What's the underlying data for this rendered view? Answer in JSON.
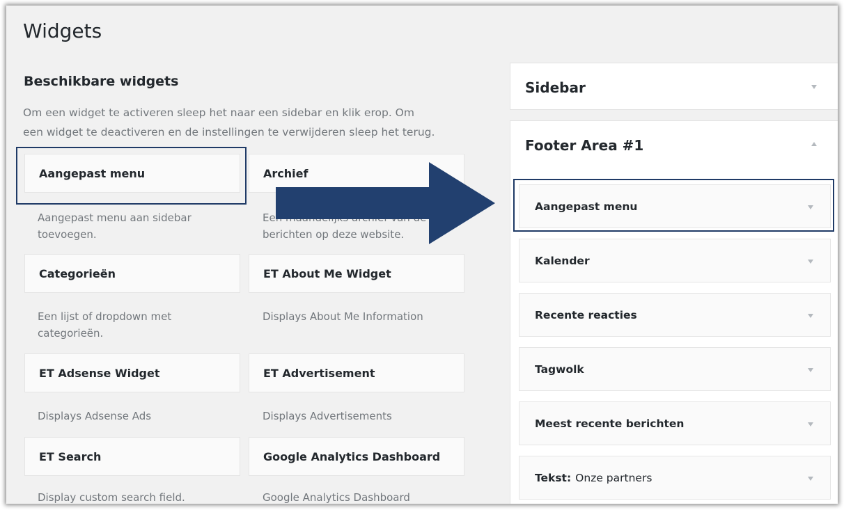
{
  "page": {
    "title": "Widgets"
  },
  "available": {
    "title": "Beschikbare widgets",
    "description_lines": [
      "Om een widget te activeren sleep het naar een sidebar en klik erop. Om",
      "een widget te deactiveren en de instellingen te verwijderen sleep het terug."
    ],
    "widgets": [
      {
        "name": "Aangepast menu",
        "desc": [
          "Aangepast menu aan sidebar",
          "toevoegen."
        ]
      },
      {
        "name": "Archief",
        "desc": [
          "Een maandelijks archief van de",
          "berichten op deze website."
        ]
      },
      {
        "name": "Categorieën",
        "desc": [
          "Een lijst of dropdown met",
          "categorieën."
        ]
      },
      {
        "name": "ET About Me Widget",
        "desc": [
          "Displays About Me Information"
        ]
      },
      {
        "name": "ET Adsense Widget",
        "desc": [
          "Displays Adsense Ads"
        ]
      },
      {
        "name": "ET Advertisement",
        "desc": [
          "Displays Advertisements"
        ]
      },
      {
        "name": "ET Search",
        "desc": [
          "Display custom search field."
        ]
      },
      {
        "name": "Google Analytics Dashboard",
        "desc": [
          "Google Analytics Dashboard"
        ]
      }
    ]
  },
  "sidebars": {
    "sidebar": {
      "title": "Sidebar"
    },
    "footer": {
      "title": "Footer Area #1",
      "widgets": [
        {
          "name": "Aangepast menu",
          "sub": ""
        },
        {
          "name": "Kalender",
          "sub": ""
        },
        {
          "name": "Recente reacties",
          "sub": ""
        },
        {
          "name": "Tagwolk",
          "sub": ""
        },
        {
          "name": "Meest recente berichten",
          "sub": ""
        },
        {
          "name": "Tekst:",
          "sub": "Onze partners"
        }
      ]
    }
  },
  "colors": {
    "highlight": "#1f3a66",
    "arrow": "#22406f"
  },
  "icons": {
    "caret_down": "caret-down-icon",
    "caret_up": "caret-up-icon",
    "drag_arrow": "drag-arrow-icon"
  }
}
